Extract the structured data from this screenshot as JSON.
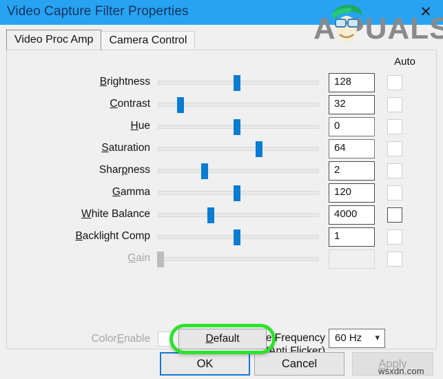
{
  "window": {
    "title": "Video Capture Filter Properties",
    "close_icon": "close-icon",
    "titlebar_color": "#27a3f2"
  },
  "watermark": {
    "brand": "APPUALS",
    "site": "wsxdn.com"
  },
  "tabs": [
    {
      "label": "Video Proc Amp",
      "selected": true
    },
    {
      "label": "Camera Control",
      "selected": false
    }
  ],
  "panel": {
    "auto_column_header": "Auto",
    "controls": [
      {
        "label_pre": "",
        "label_accel": "B",
        "label_post": "rightness",
        "value": "128",
        "percent": 49,
        "auto_checked": false,
        "auto_enabled": false,
        "disabled": false,
        "value_strong": true
      },
      {
        "label_pre": "",
        "label_accel": "C",
        "label_post": "ontrast",
        "value": "32",
        "percent": 14,
        "auto_checked": false,
        "auto_enabled": false,
        "disabled": false,
        "value_strong": true
      },
      {
        "label_pre": "",
        "label_accel": "H",
        "label_post": "ue",
        "value": "0",
        "percent": 49,
        "auto_checked": false,
        "auto_enabled": false,
        "disabled": false,
        "value_strong": false
      },
      {
        "label_pre": "",
        "label_accel": "S",
        "label_post": "aturation",
        "value": "64",
        "percent": 63,
        "auto_checked": false,
        "auto_enabled": false,
        "disabled": false,
        "value_strong": false
      },
      {
        "label_pre": "Shar",
        "label_accel": "p",
        "label_post": "ness",
        "value": "2",
        "percent": 29,
        "auto_checked": false,
        "auto_enabled": false,
        "disabled": false,
        "value_strong": true
      },
      {
        "label_pre": "",
        "label_accel": "G",
        "label_post": "amma",
        "value": "120",
        "percent": 49,
        "auto_checked": false,
        "auto_enabled": false,
        "disabled": false,
        "value_strong": true
      },
      {
        "label_pre": "",
        "label_accel": "W",
        "label_post": "hite Balance",
        "value": "4000",
        "percent": 33,
        "auto_checked": false,
        "auto_enabled": true,
        "disabled": false,
        "value_strong": true
      },
      {
        "label_pre": "",
        "label_accel": "B",
        "label_post": "acklight Comp",
        "value": "1",
        "percent": 49,
        "auto_checked": false,
        "auto_enabled": false,
        "disabled": false,
        "value_strong": true
      },
      {
        "label_pre": "",
        "label_accel": "G",
        "label_post": "ain",
        "value": "",
        "percent": 1.5,
        "auto_checked": false,
        "auto_enabled": false,
        "disabled": true,
        "value_strong": false
      }
    ],
    "color_enable": {
      "label_pre": "Color",
      "label_accel": "E",
      "label_post": "nable",
      "checked": false,
      "disabled": true
    },
    "powerline": {
      "label_pre": "",
      "label_accel": "P",
      "label_post": "owerLine Frequency",
      "label_line2": "(Anti Flicker)",
      "value": "60 Hz",
      "arrow_icon": "chevron-down-icon"
    }
  },
  "default_button": {
    "label_pre": "",
    "label_accel": "D",
    "label_post": "efault",
    "highlight_color": "#2ce22c"
  },
  "footer": {
    "ok": "OK",
    "cancel": "Cancel",
    "apply_pre": "",
    "apply_accel": "A",
    "apply_post": "pply",
    "apply_disabled": true
  }
}
